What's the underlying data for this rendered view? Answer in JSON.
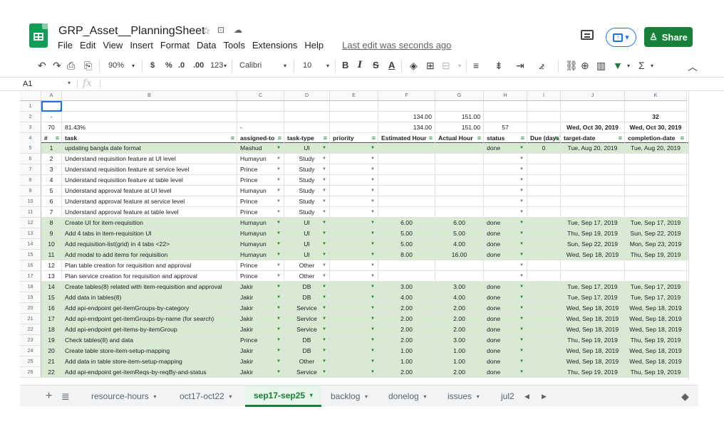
{
  "header": {
    "doc_title": "GRP_Asset__PlanningSheet",
    "menu": [
      "File",
      "Edit",
      "View",
      "Insert",
      "Format",
      "Data",
      "Tools",
      "Extensions",
      "Help"
    ],
    "last_edit": "Last edit was seconds ago",
    "share_label": "Share"
  },
  "toolbar": {
    "zoom": "90%",
    "currency": "$",
    "percent": "%",
    "dec_decrease": ".0",
    "dec_increase": ".00",
    "number_format": "123",
    "font": "Calibri",
    "font_size": "10",
    "bold": "B",
    "italic": "I",
    "strike": "S",
    "text_color": "A"
  },
  "formula_bar": {
    "cell_ref": "A1",
    "fx": "fx",
    "value": ""
  },
  "columns": [
    "A",
    "B",
    "C",
    "D",
    "E",
    "F",
    "G",
    "H",
    "I",
    "J",
    "K"
  ],
  "row_numbers": [
    "1",
    "2",
    "3",
    "4",
    "5",
    "6",
    "7",
    "8",
    "9",
    "10",
    "11",
    "12",
    "13",
    "14",
    "15",
    "16",
    "17",
    "18",
    "19",
    "20",
    "21",
    "22",
    "23",
    "24",
    "25",
    "26"
  ],
  "row2": {
    "a": "-",
    "f": "134.00",
    "g": "151.00",
    "k": "32"
  },
  "row3": {
    "a": "70",
    "b": "81.43%",
    "c": "-",
    "f": "134.00",
    "g": "151.00",
    "h": "57",
    "j": "Wed, Oct 30, 2019",
    "k": "Wed, Oct 30, 2019"
  },
  "headers": [
    "#",
    "task",
    "assigned-to",
    "task-type",
    "priority",
    "Estimated Hour",
    "Actual Hour",
    "status",
    "Due (days)",
    "target-date",
    "completion-date",
    "la"
  ],
  "rows": [
    {
      "n": "1",
      "task": "updating  bangla date format",
      "who": "Mashud",
      "type": "UI",
      "est": "",
      "act": "",
      "status": "done",
      "due": "0",
      "target": "Tue, Aug 20, 2019",
      "done_date": "Tue, Aug 20, 2019",
      "green": true
    },
    {
      "n": "2",
      "task": "Understand requisition feature at UI level",
      "who": "Humayun",
      "type": "Study",
      "est": "",
      "act": "",
      "status": "",
      "due": "",
      "target": "",
      "done_date": "",
      "green": false
    },
    {
      "n": "3",
      "task": "Understand requisition feature at service level",
      "who": "Prince",
      "type": "Study",
      "est": "",
      "act": "",
      "status": "",
      "due": "",
      "target": "",
      "done_date": "",
      "green": false
    },
    {
      "n": "4",
      "task": "Understand requisition feature at table level",
      "who": "Prince",
      "type": "Study",
      "est": "",
      "act": "",
      "status": "",
      "due": "",
      "target": "",
      "done_date": "",
      "green": false
    },
    {
      "n": "5",
      "task": "Understand approval feature at UI level",
      "who": "Humayun",
      "type": "Study",
      "est": "",
      "act": "",
      "status": "",
      "due": "",
      "target": "",
      "done_date": "",
      "green": false
    },
    {
      "n": "6",
      "task": "Understand approval feature at service level",
      "who": "Prince",
      "type": "Study",
      "est": "",
      "act": "",
      "status": "",
      "due": "",
      "target": "",
      "done_date": "",
      "green": false
    },
    {
      "n": "7",
      "task": "Understand approval feature at table level",
      "who": "Prince",
      "type": "Study",
      "est": "",
      "act": "",
      "status": "",
      "due": "",
      "target": "",
      "done_date": "",
      "green": false
    },
    {
      "n": "8",
      "task": "Create UI for item-requisition",
      "who": "Humayun",
      "type": "UI",
      "est": "6.00",
      "act": "6.00",
      "status": "done",
      "due": "",
      "target": "Tue, Sep 17, 2019",
      "done_date": "Tue, Sep 17, 2019",
      "green": true
    },
    {
      "n": "9",
      "task": "Add 4 tabs in item-requisition UI",
      "who": "Humayun",
      "type": "UI",
      "est": "5.00",
      "act": "5.00",
      "status": "done",
      "due": "",
      "target": "Thu, Sep 19, 2019",
      "done_date": "Sun, Sep 22, 2019",
      "green": true
    },
    {
      "n": "10",
      "task": "Add requisition-list(grid) in 4 tabs <22>",
      "who": "Humayun",
      "type": "UI",
      "est": "5.00",
      "act": "4.00",
      "status": "done",
      "due": "",
      "target": "Sun, Sep 22, 2019",
      "done_date": "Mon, Sep 23, 2019",
      "green": true
    },
    {
      "n": "11",
      "task": "Add modal to add items for requisition",
      "who": "Humayun",
      "type": "UI",
      "est": "8.00",
      "act": "16.00",
      "status": "done",
      "due": "",
      "target": "Wed, Sep 18, 2019",
      "done_date": "Thu, Sep 19, 2019",
      "green": true
    },
    {
      "n": "12",
      "task": "Plan table creation for requisition and approval",
      "who": "Prince",
      "type": "Other",
      "est": "",
      "act": "",
      "status": "",
      "due": "",
      "target": "",
      "done_date": "",
      "green": false
    },
    {
      "n": "13",
      "task": "Plan service creation for requisition and approval",
      "who": "Prince",
      "type": "Other",
      "est": "",
      "act": "",
      "status": "",
      "due": "",
      "target": "",
      "done_date": "",
      "green": false
    },
    {
      "n": "14",
      "task": "Create tables(8) related with item-requisition and approval",
      "who": "Jakir",
      "type": "DB",
      "est": "3.00",
      "act": "3.00",
      "status": "done",
      "due": "",
      "target": "Tue, Sep 17, 2019",
      "done_date": "Tue, Sep 17, 2019",
      "green": true
    },
    {
      "n": "15",
      "task": "Add data in tables(8)",
      "who": "Jakir",
      "type": "DB",
      "est": "4.00",
      "act": "4.00",
      "status": "done",
      "due": "",
      "target": "Tue, Sep 17, 2019",
      "done_date": "Tue, Sep 17, 2019",
      "green": true
    },
    {
      "n": "16",
      "task": "Add api-endpoint get-itemGroups-by-category",
      "who": "Jakir",
      "type": "Service",
      "est": "2.00",
      "act": "2.00",
      "status": "done",
      "due": "",
      "target": "Wed, Sep 18, 2019",
      "done_date": "Wed, Sep 18, 2019",
      "green": true
    },
    {
      "n": "17",
      "task": "Add api-endpoint get-itemGroups-by-name (for search)",
      "who": "Jakir",
      "type": "Service",
      "est": "2.00",
      "act": "2.00",
      "status": "done",
      "due": "",
      "target": "Wed, Sep 18, 2019",
      "done_date": "Wed, Sep 18, 2019",
      "green": true
    },
    {
      "n": "18",
      "task": "Add api-endpoint get-items-by-itemGroup",
      "who": "Jakir",
      "type": "Service",
      "est": "2.00",
      "act": "2.00",
      "status": "done",
      "due": "",
      "target": "Wed, Sep 18, 2019",
      "done_date": "Wed, Sep 18, 2019",
      "green": true
    },
    {
      "n": "19",
      "task": "Check tables(8) and data",
      "who": "Prince",
      "type": "DB",
      "est": "2.00",
      "act": "3.00",
      "status": "done",
      "due": "",
      "target": "Thu, Sep 19, 2019",
      "done_date": "Thu, Sep 19, 2019",
      "green": true
    },
    {
      "n": "20",
      "task": "Create table store-item-setup-mapping",
      "who": "Jakir",
      "type": "DB",
      "est": "1.00",
      "act": "1.00",
      "status": "done",
      "due": "",
      "target": "Wed, Sep 18, 2019",
      "done_date": "Wed, Sep 18, 2019",
      "green": true
    },
    {
      "n": "21",
      "task": "Add data in table store-item-setup-mapping",
      "who": "Jakir",
      "type": "Other",
      "est": "1.00",
      "act": "1.00",
      "status": "done",
      "due": "",
      "target": "Wed, Sep 18, 2019",
      "done_date": "Wed, Sep 18, 2019",
      "green": true
    },
    {
      "n": "22",
      "task": "Add api-endpoint get-itemReqs-by-reqBy-and-status",
      "who": "Jakir",
      "type": "Service",
      "est": "2.00",
      "act": "2.00",
      "status": "done",
      "due": "",
      "target": "Thu, Sep 19, 2019",
      "done_date": "Thu, Sep 19, 2019",
      "green": true
    }
  ],
  "sheet_tabs": [
    "resource-hours",
    "oct17-oct22",
    "sep17-sep25",
    "backlog",
    "donelog",
    "issues",
    "jul2"
  ],
  "active_tab": "sep17-sep25",
  "colors": {
    "accent": "#188038",
    "row_green": "#d9ead3",
    "header_bg": "#f8f9fa"
  }
}
